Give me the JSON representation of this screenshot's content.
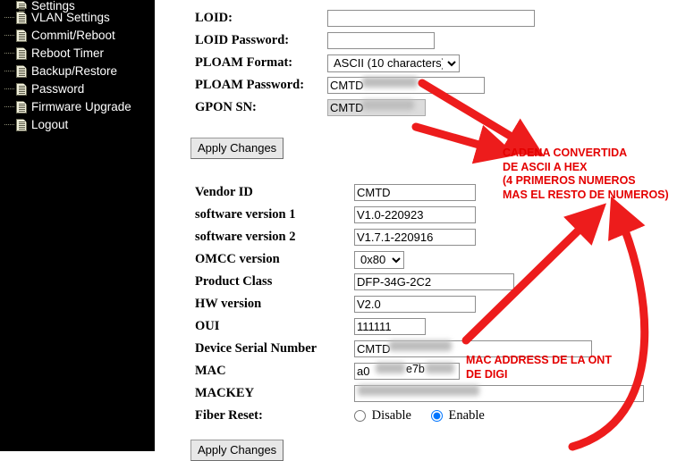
{
  "sidebar": {
    "items": [
      {
        "label": "Settings",
        "icon": "document-icon",
        "clipped": true
      },
      {
        "label": "VLAN Settings",
        "icon": "document-icon",
        "clipped": false
      },
      {
        "label": "Commit/Reboot",
        "icon": "document-icon",
        "clipped": false
      },
      {
        "label": "Reboot Timer",
        "icon": "document-icon",
        "clipped": false
      },
      {
        "label": "Backup/Restore",
        "icon": "document-icon",
        "clipped": false
      },
      {
        "label": "Password",
        "icon": "document-icon",
        "clipped": false
      },
      {
        "label": "Firmware Upgrade",
        "icon": "document-icon",
        "clipped": false
      },
      {
        "label": "Logout",
        "icon": "document-icon",
        "clipped": false
      }
    ]
  },
  "gpon_form": {
    "fields": [
      {
        "label": "LOID:",
        "value": "",
        "type": "text",
        "disabled": false,
        "redacted": false
      },
      {
        "label": "LOID Password:",
        "value": "",
        "type": "text",
        "disabled": false,
        "redacted": false
      },
      {
        "label": "PLOAM Format:",
        "value": "ASCII (10 characters)",
        "type": "select",
        "disabled": false,
        "redacted": false
      },
      {
        "label": "PLOAM Password:",
        "value": "CMTD",
        "type": "text",
        "disabled": false,
        "redacted": true
      },
      {
        "label": "GPON SN:",
        "value": "CMTD",
        "type": "text",
        "disabled": true,
        "redacted": true
      }
    ],
    "apply_label": "Apply Changes"
  },
  "device_form": {
    "fields": [
      {
        "label": "Vendor ID",
        "value": "CMTD",
        "type": "text",
        "disabled": false,
        "redacted": false
      },
      {
        "label": "software version 1",
        "value": "V1.0-220923",
        "type": "text",
        "disabled": false,
        "redacted": false
      },
      {
        "label": "software version 2",
        "value": "V1.7.1-220916",
        "type": "text",
        "disabled": false,
        "redacted": false
      },
      {
        "label": "OMCC version",
        "value": "0x80",
        "type": "select",
        "disabled": false,
        "redacted": false
      },
      {
        "label": "Product Class",
        "value": "DFP-34G-2C2",
        "type": "text",
        "disabled": false,
        "redacted": false
      },
      {
        "label": "HW version",
        "value": "V2.0",
        "type": "text",
        "disabled": false,
        "redacted": false
      },
      {
        "label": "OUI",
        "value": "111111",
        "type": "text",
        "disabled": false,
        "redacted": false
      },
      {
        "label": "Device Serial Number",
        "value": "CMTD",
        "type": "text",
        "disabled": false,
        "redacted": true
      },
      {
        "label": "MAC",
        "value": "a0",
        "value2": "e7b",
        "type": "text",
        "disabled": false,
        "redacted": true
      },
      {
        "label": "MACKEY",
        "value": "",
        "type": "text",
        "disabled": false,
        "redacted": true
      }
    ],
    "fiber_reset": {
      "label": "Fiber Reset:",
      "options": [
        {
          "label": "Disable",
          "selected": false
        },
        {
          "label": "Enable",
          "selected": true
        }
      ]
    },
    "apply_label": "Apply Changes"
  },
  "annotations": {
    "accent_color": "#e40000",
    "notes": [
      {
        "id": "ploam-note",
        "lines": [
          "CADENA CONVERTIDA",
          "DE ASCII A HEX",
          "(4 PRIMEROS NUMEROS",
          "MAS EL RESTO DE NUMEROS)"
        ]
      },
      {
        "id": "mac-note",
        "lines": [
          "MAC ADDRESS DE LA ONT",
          "DE DIGI"
        ]
      }
    ]
  }
}
